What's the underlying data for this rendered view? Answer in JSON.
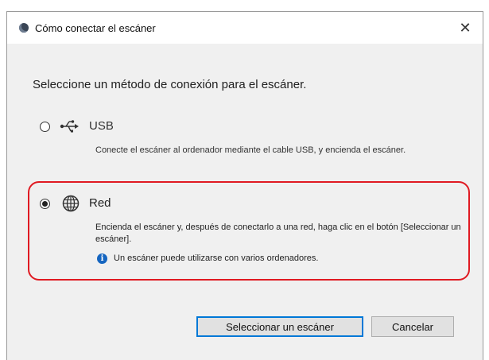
{
  "window": {
    "title": "Cómo conectar el escáner",
    "close_symbol": "✕",
    "app_icon": "scanner-app-icon"
  },
  "prompt": "Seleccione un método de conexión para el escáner.",
  "options": [
    {
      "id": "usb",
      "label": "USB",
      "icon": "usb-icon",
      "selected": false,
      "description": "Conecte el escáner al ordenador mediante el cable USB, y encienda el escáner."
    },
    {
      "id": "red",
      "label": "Red",
      "icon": "globe-icon",
      "selected": true,
      "description": "Encienda el escáner y, después de conectarlo a una red, haga clic en el botón [Seleccionar un escáner].",
      "info": "Un escáner puede utilizarse con varios ordenadores."
    }
  ],
  "buttons": {
    "select": "Seleccionar un escáner",
    "cancel": "Cancelar"
  },
  "colors": {
    "highlight": "#e01a22",
    "info": "#1565c0",
    "focus": "#0078d7"
  }
}
